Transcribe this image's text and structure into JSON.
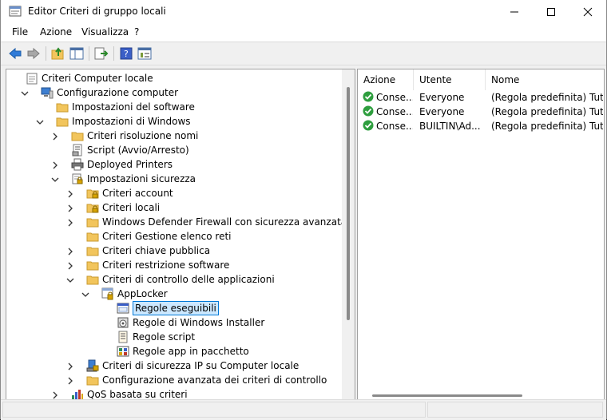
{
  "window": {
    "title": "Editor Criteri di gruppo locali"
  },
  "menu": [
    "File",
    "Azione",
    "Visualizza",
    "?"
  ],
  "toolbar": {
    "buttons": [
      "back-icon",
      "forward-icon",
      "up-folder-icon",
      "show-hide-tree-icon",
      "export-list-icon",
      "help-icon",
      "properties-icon"
    ]
  },
  "tree": [
    {
      "label": "Criteri Computer locale",
      "icon": "computer-policy-icon",
      "level": 0,
      "chevron": "none"
    },
    {
      "label": "Configurazione computer",
      "icon": "computer-icon",
      "level": 1,
      "chevron": "expanded"
    },
    {
      "label": "Impostazioni del software",
      "icon": "folder-icon",
      "level": 2,
      "chevron": "none"
    },
    {
      "label": "Impostazioni di Windows",
      "icon": "folder-icon",
      "level": 2,
      "chevron": "expanded"
    },
    {
      "label": "Criteri risoluzione nomi",
      "icon": "folder-icon",
      "level": 3,
      "chevron": "collapsed"
    },
    {
      "label": "Script (Avvio/Arresto)",
      "icon": "script-icon",
      "level": 3,
      "chevron": "none"
    },
    {
      "label": "Deployed Printers",
      "icon": "printer-icon",
      "level": 3,
      "chevron": "collapsed"
    },
    {
      "label": "Impostazioni sicurezza",
      "icon": "security-settings-icon",
      "level": 3,
      "chevron": "expanded"
    },
    {
      "label": "Criteri account",
      "icon": "folder-lock-icon",
      "level": 4,
      "chevron": "collapsed"
    },
    {
      "label": "Criteri locali",
      "icon": "folder-lock-icon",
      "level": 4,
      "chevron": "collapsed"
    },
    {
      "label": "Windows Defender Firewall con sicurezza avanzata",
      "icon": "folder-icon",
      "level": 4,
      "chevron": "collapsed"
    },
    {
      "label": "Criteri Gestione elenco reti",
      "icon": "folder-icon",
      "level": 4,
      "chevron": "none"
    },
    {
      "label": "Criteri chiave pubblica",
      "icon": "folder-icon",
      "level": 4,
      "chevron": "collapsed"
    },
    {
      "label": "Criteri restrizione software",
      "icon": "folder-icon",
      "level": 4,
      "chevron": "collapsed"
    },
    {
      "label": "Criteri di controllo delle applicazioni",
      "icon": "folder-icon",
      "level": 4,
      "chevron": "expanded"
    },
    {
      "label": "AppLocker",
      "icon": "applocker-icon",
      "level": 5,
      "chevron": "expanded"
    },
    {
      "label": "Regole eseguibili",
      "icon": "exe-rules-icon",
      "level": 6,
      "chevron": "none",
      "selected": true
    },
    {
      "label": "Regole di Windows Installer",
      "icon": "installer-rules-icon",
      "level": 6,
      "chevron": "none"
    },
    {
      "label": "Regole script",
      "icon": "script-rules-icon",
      "level": 6,
      "chevron": "none"
    },
    {
      "label": "Regole app in pacchetto",
      "icon": "packaged-app-rules-icon",
      "level": 6,
      "chevron": "none"
    },
    {
      "label": "Criteri di sicurezza IP su Computer locale",
      "icon": "ipsec-icon",
      "level": 4,
      "chevron": "collapsed"
    },
    {
      "label": "Configurazione avanzata dei criteri di controllo",
      "icon": "folder-icon",
      "level": 4,
      "chevron": "collapsed"
    },
    {
      "label": "QoS basata su criteri",
      "icon": "qos-chart-icon",
      "level": 3,
      "chevron": "collapsed"
    }
  ],
  "detail": {
    "columns": [
      "Azione",
      "Utente",
      "Nome"
    ],
    "rows": [
      {
        "action": "Conse...",
        "user": "Everyone",
        "name": "(Regola predefinita) Tutti i"
      },
      {
        "action": "Conse...",
        "user": "Everyone",
        "name": "(Regola predefinita) Tutti i"
      },
      {
        "action": "Conse...",
        "user": "BUILTIN\\Ad...",
        "name": "(Regola predefinita) Tutti i"
      }
    ]
  },
  "colors": {
    "allow_check": "#2e9e3e",
    "folder": "#f2c55c",
    "selection": "#cce8ff",
    "selection_border": "#0078d7"
  }
}
